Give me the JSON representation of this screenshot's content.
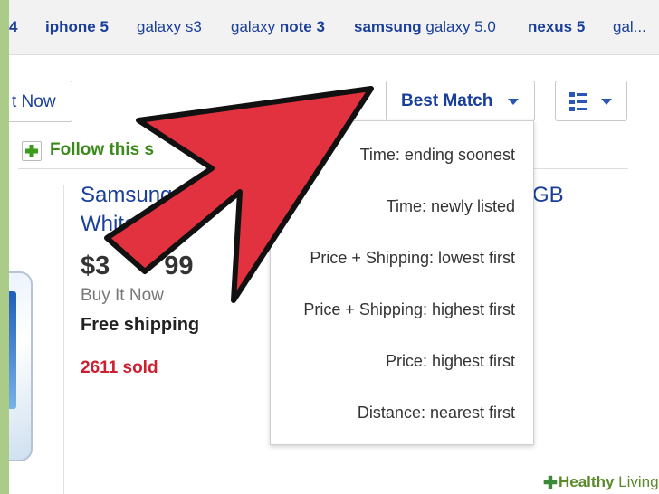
{
  "related_searches": [
    {
      "prefix": "",
      "bold": "4",
      "suffix": ""
    },
    {
      "prefix": "",
      "bold": "iphone 5",
      "suffix": ""
    },
    {
      "prefix": "galaxy s3",
      "bold": "",
      "suffix": ""
    },
    {
      "prefix": "galaxy ",
      "bold": "note 3",
      "suffix": ""
    },
    {
      "prefix": "",
      "bold": "samsung",
      "suffix": " galaxy 5.0"
    },
    {
      "prefix": "",
      "bold": "nexus 5",
      "suffix": ""
    },
    {
      "prefix": "gal...",
      "bold": "",
      "suffix": ""
    }
  ],
  "toolbar": {
    "buy_now_label": "t Now",
    "sort_label": "Best Match",
    "follow_label": "Follow this s"
  },
  "listing": {
    "title_line1": "Samsung",
    "title_line2": "White",
    "title_right": "GB",
    "price": "$3",
    "price_tail": "99",
    "format": "Buy It Now",
    "shipping": "Free shipping",
    "sold": "2611 sold"
  },
  "sort_menu": {
    "items": [
      "Time: ending soonest",
      "Time: newly listed",
      "Price + Shipping: lowest first",
      "Price + Shipping: highest first",
      "Price: highest first",
      "Distance: nearest first"
    ]
  },
  "icons": {
    "view": "list-view-icon",
    "follow": "plus-icon",
    "arrow": "red-pointer-arrow"
  },
  "colors": {
    "link_blue": "#1a3f9b",
    "sold_red": "#cc1f2f",
    "follow_green": "#3a8a1a",
    "arrow_red": "#e2323f"
  },
  "watermark": {
    "brand_bold": "Healthy",
    "brand_light": " Living"
  }
}
